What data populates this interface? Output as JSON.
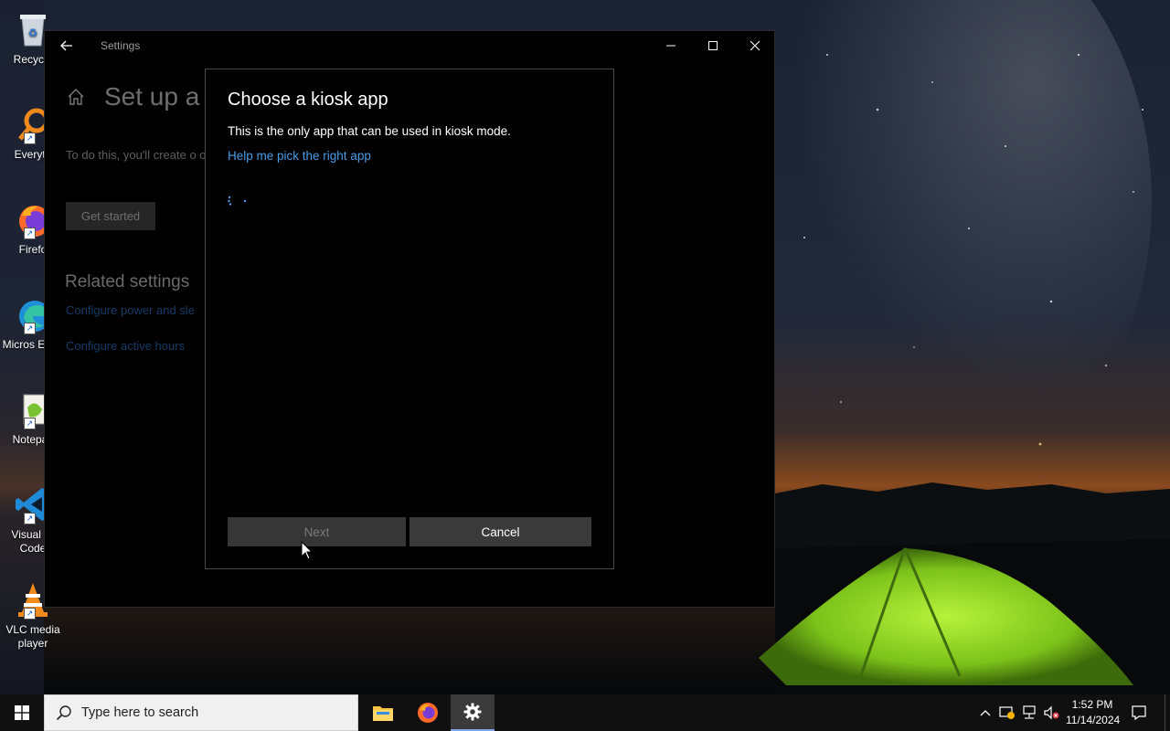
{
  "desktop": {
    "icons": [
      {
        "label": "Recycle"
      },
      {
        "label": "Everyth"
      },
      {
        "label": "Firefo"
      },
      {
        "label": "Micros Edge"
      },
      {
        "label": "Notepac"
      },
      {
        "label": "Visual St Code"
      },
      {
        "label": "VLC media player"
      }
    ]
  },
  "settings": {
    "window_title": "Settings",
    "page_title": "Set up a k",
    "description": "To do this, you'll create o only app that it can use (",
    "get_started_label": "Get started",
    "related_title": "Related settings",
    "links": [
      "Configure power and sle",
      "Configure active hours"
    ]
  },
  "dialog": {
    "title": "Choose a kiosk app",
    "description": "This is the only app that can be used in kiosk mode.",
    "help_link": "Help me pick the right app",
    "next_label": "Next",
    "cancel_label": "Cancel"
  },
  "taskbar": {
    "search_placeholder": "Type here to search",
    "time": "1:52 PM",
    "date": "11/14/2024",
    "apps": [
      "file-explorer",
      "firefox",
      "settings"
    ]
  },
  "colors": {
    "link_blue": "#4a9ce8",
    "dialog_bg": "#000000",
    "taskbar_bg": "#101010",
    "active_indicator": "#7aa7e6"
  }
}
